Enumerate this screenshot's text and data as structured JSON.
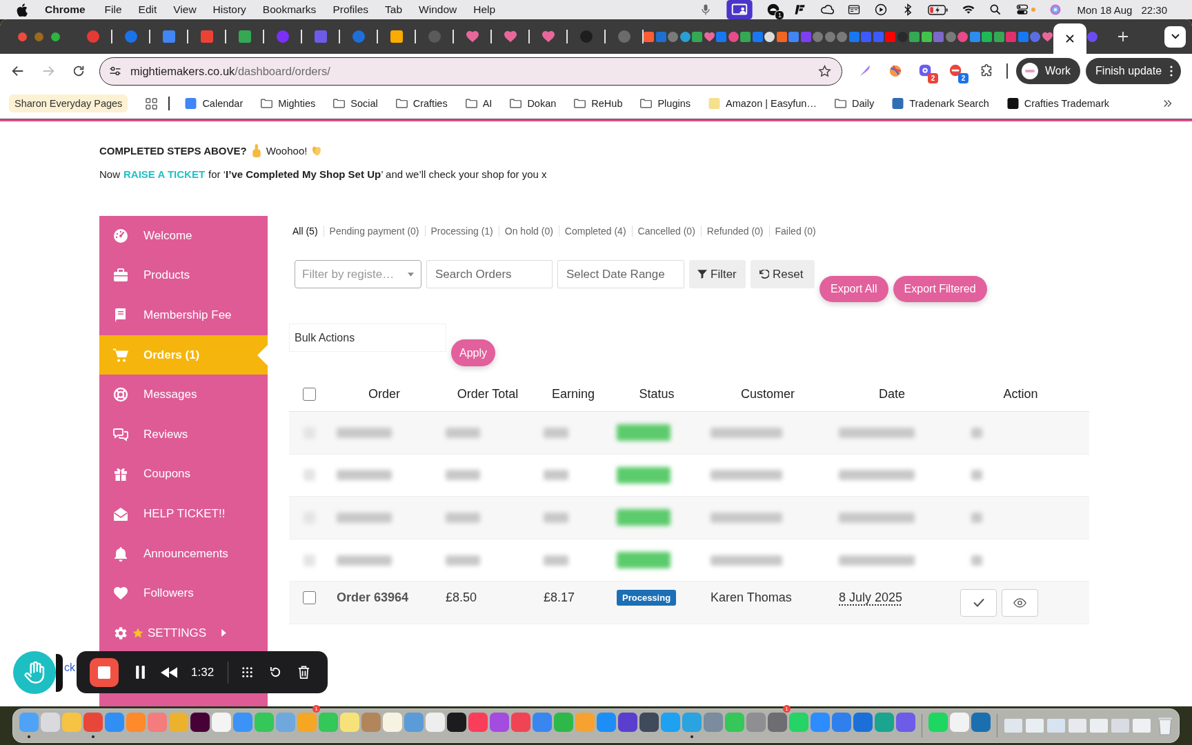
{
  "menu_bar": {
    "app": "Chrome",
    "menus": [
      "File",
      "Edit",
      "View",
      "History",
      "Bookmarks",
      "Profiles",
      "Tab",
      "Window",
      "Help"
    ],
    "status_badge": "1",
    "date": "Mon 18 Aug",
    "time": "22:30"
  },
  "tabs": [
    {
      "pinned": true,
      "selected": false,
      "kind": "circle",
      "color": "#e53935"
    },
    {
      "pinned": true,
      "selected": false,
      "kind": "circle",
      "color": "#1a73e8"
    },
    {
      "pinned": true,
      "selected": false,
      "kind": "square",
      "color": "#4285f4"
    },
    {
      "pinned": true,
      "selected": false,
      "kind": "square",
      "color": "#ea4335"
    },
    {
      "pinned": true,
      "selected": false,
      "kind": "square",
      "color": "#34a853"
    },
    {
      "pinned": true,
      "selected": false,
      "kind": "circle",
      "color": "#7b2ff7"
    },
    {
      "pinned": true,
      "selected": false,
      "kind": "square",
      "color": "#6c5ce7"
    },
    {
      "pinned": true,
      "selected": false,
      "kind": "circle",
      "color": "#1e6fd9"
    },
    {
      "pinned": true,
      "selected": false,
      "kind": "square",
      "color": "#f9ab00"
    },
    {
      "pinned": true,
      "selected": false,
      "kind": "circle",
      "color": "#5a5a5a"
    },
    {
      "pinned": true,
      "selected": false,
      "kind": "heart",
      "color": "#e8679a"
    },
    {
      "pinned": true,
      "selected": false,
      "kind": "heart",
      "color": "#e8679a"
    },
    {
      "pinned": true,
      "selected": false,
      "kind": "heart",
      "color": "#e8679a"
    },
    {
      "pinned": true,
      "selected": false,
      "kind": "circle",
      "color": "#1e1e1e"
    },
    {
      "pinned": true,
      "selected": false,
      "kind": "circle",
      "color": "#6b6b6b"
    },
    {
      "pinned": false,
      "selected": false,
      "kind": "square",
      "color": "#ff5c35"
    },
    {
      "pinned": false,
      "selected": false,
      "kind": "square",
      "color": "#1f6fd1"
    },
    {
      "pinned": false,
      "selected": false,
      "kind": "circle",
      "color": "#7a7a7a"
    },
    {
      "pinned": false,
      "selected": false,
      "kind": "circle",
      "color": "#2a9fd6"
    },
    {
      "pinned": false,
      "selected": false,
      "kind": "square",
      "color": "#34a853"
    },
    {
      "pinned": false,
      "selected": false,
      "kind": "heart",
      "color": "#e8679a"
    },
    {
      "pinned": false,
      "selected": false,
      "kind": "square",
      "color": "#1877f2"
    },
    {
      "pinned": false,
      "selected": false,
      "kind": "circle",
      "color": "#e84a8a"
    },
    {
      "pinned": false,
      "selected": false,
      "kind": "square",
      "color": "#34a853"
    },
    {
      "pinned": false,
      "selected": false,
      "kind": "square",
      "color": "#1877f2"
    },
    {
      "pinned": false,
      "selected": false,
      "kind": "circle",
      "color": "#dddddd"
    },
    {
      "pinned": false,
      "selected": false,
      "kind": "square",
      "color": "#f26522"
    },
    {
      "pinned": false,
      "selected": false,
      "kind": "square",
      "color": "#4285f4"
    },
    {
      "pinned": false,
      "selected": false,
      "kind": "square",
      "color": "#7e3ff2"
    },
    {
      "pinned": false,
      "selected": false,
      "kind": "circle",
      "color": "#7a7a7a"
    },
    {
      "pinned": false,
      "selected": false,
      "kind": "circle",
      "color": "#7a7a7a"
    },
    {
      "pinned": false,
      "selected": false,
      "kind": "circle",
      "color": "#7a7a7a"
    },
    {
      "pinned": false,
      "selected": false,
      "kind": "square",
      "color": "#1877f2"
    },
    {
      "pinned": false,
      "selected": false,
      "kind": "square",
      "color": "#3d5afe"
    },
    {
      "pinned": false,
      "selected": false,
      "kind": "square",
      "color": "#3d5afe"
    },
    {
      "pinned": false,
      "selected": false,
      "kind": "square",
      "color": "#ff0000"
    },
    {
      "pinned": false,
      "selected": false,
      "kind": "circle",
      "color": "#2a2a2a"
    },
    {
      "pinned": false,
      "selected": false,
      "kind": "square",
      "color": "#34a853"
    },
    {
      "pinned": false,
      "selected": false,
      "kind": "square",
      "color": "#43c24b"
    },
    {
      "pinned": false,
      "selected": false,
      "kind": "square",
      "color": "#7b68c8"
    },
    {
      "pinned": false,
      "selected": false,
      "kind": "circle",
      "color": "#7a7a7a"
    },
    {
      "pinned": false,
      "selected": false,
      "kind": "circle",
      "color": "#e84a8a"
    },
    {
      "pinned": false,
      "selected": false,
      "kind": "square",
      "color": "#2d8cf0"
    },
    {
      "pinned": false,
      "selected": false,
      "kind": "square",
      "color": "#1db954"
    },
    {
      "pinned": false,
      "selected": false,
      "kind": "square",
      "color": "#34a853"
    },
    {
      "pinned": false,
      "selected": false,
      "kind": "square",
      "color": "#e1306c"
    },
    {
      "pinned": false,
      "selected": false,
      "kind": "square",
      "color": "#1877f2"
    },
    {
      "pinned": false,
      "selected": false,
      "kind": "circle",
      "color": "#5b6ee1"
    },
    {
      "pinned": false,
      "selected": false,
      "kind": "heart",
      "color": "#e8679a"
    },
    {
      "pinned": false,
      "selected": true
    },
    {
      "pinned": false,
      "selected": false,
      "kind": "circle",
      "color": "#6a4cf0"
    }
  ],
  "toolbar": {
    "url_host": "mightiemakers.co.uk",
    "url_path": "/dashboard/orders/",
    "extensions": [
      {
        "badge": "2",
        "color": "#e8453c"
      },
      {
        "badge": "2",
        "color": "#1a73e8"
      }
    ],
    "profile": "Work",
    "update_button": "Finish update"
  },
  "bookmarks": {
    "tab_group": "Sharon Everyday Pages",
    "items": [
      {
        "kind": "site",
        "label": "Calendar",
        "color": "#4285f4"
      },
      {
        "kind": "folder",
        "label": "Mighties"
      },
      {
        "kind": "folder",
        "label": "Social"
      },
      {
        "kind": "folder",
        "label": "Crafties"
      },
      {
        "kind": "folder",
        "label": "AI"
      },
      {
        "kind": "folder",
        "label": "Dokan"
      },
      {
        "kind": "folder",
        "label": "ReHub"
      },
      {
        "kind": "folder",
        "label": "Plugins"
      },
      {
        "kind": "site",
        "label": "Amazon | Easyfun…",
        "color": "#f5e08c"
      },
      {
        "kind": "folder",
        "label": "Daily"
      },
      {
        "kind": "site",
        "label": "Tradenark Search",
        "color": "#2f6db5"
      },
      {
        "kind": "site",
        "label": "Crafties Trademark",
        "color": "#111111"
      }
    ]
  },
  "page": {
    "notice": {
      "title": "COMPLETED STEPS ABOVE?",
      "cheer": "Woohoo!",
      "lead": "Now",
      "link": "RAISE A TICKET",
      "rest": "for ‘**I’ve Completed My Shop Set Up**’ and we’ll check your shop for you x"
    },
    "sidebar": [
      {
        "label": "Welcome",
        "selected": false,
        "starred": false,
        "kind": "link"
      },
      {
        "label": "Products",
        "selected": false,
        "starred": false,
        "kind": "link"
      },
      {
        "label": "Membership Fee",
        "selected": false,
        "starred": false,
        "kind": "link"
      },
      {
        "label": "Orders (1)",
        "selected": true,
        "starred": false,
        "kind": "link"
      },
      {
        "label": "Messages",
        "selected": false,
        "starred": false,
        "kind": "link"
      },
      {
        "label": "Reviews",
        "selected": false,
        "starred": false,
        "kind": "link"
      },
      {
        "label": "Coupons",
        "selected": false,
        "starred": false,
        "kind": "link"
      },
      {
        "label": "HELP TICKET!!",
        "selected": false,
        "starred": false,
        "kind": "link"
      },
      {
        "label": "Announcements",
        "selected": false,
        "starred": false,
        "kind": "link"
      },
      {
        "label": "Followers",
        "selected": false,
        "starred": false,
        "kind": "link"
      },
      {
        "label": "SETTINGS",
        "selected": false,
        "starred": true,
        "kind": "submenu"
      }
    ],
    "status_filters": [
      {
        "label": "All (5)",
        "selected": true
      },
      {
        "label": "Pending payment (0)",
        "selected": false
      },
      {
        "label": "Processing (1)",
        "selected": false
      },
      {
        "label": "On hold (0)",
        "selected": false
      },
      {
        "label": "Completed (4)",
        "selected": false
      },
      {
        "label": "Cancelled (0)",
        "selected": false
      },
      {
        "label": "Refunded (0)",
        "selected": false
      },
      {
        "label": "Failed (0)",
        "selected": false
      }
    ],
    "filters": {
      "customer_placeholder": "Filter by registe…",
      "search_placeholder": "Search Orders",
      "date_placeholder": "Select Date Range",
      "filter_button": "Filter",
      "reset_button": "Reset",
      "export_buttons": [
        "Export All",
        "Export Filtered"
      ]
    },
    "bulk": {
      "action": "Bulk Actions",
      "apply_button": "Apply"
    },
    "table": {
      "select_all_checked": false,
      "columns": [
        "Order",
        "Order Total",
        "Earning",
        "Status",
        "Customer",
        "Date",
        "Action"
      ],
      "rows": [
        {
          "kind": "blurred"
        },
        {
          "kind": "blurred"
        },
        {
          "kind": "blurred"
        },
        {
          "kind": "blurred"
        },
        {
          "kind": "order",
          "checked": false,
          "order": "Order 63964",
          "total": "£8.50",
          "earning": "£8.17",
          "status": "Processing",
          "customer": "Karen Thomas",
          "date": "8 July 2025"
        }
      ]
    }
  },
  "recorder": {
    "partial_link": "ck",
    "elapsed": "1:32"
  },
  "dock": {
    "apps": [
      {
        "color": "#4fa3f7",
        "running": true
      },
      {
        "color": "#d9d9de",
        "running": false
      },
      {
        "color": "#f6c343",
        "running": false
      },
      {
        "color": "#e9463a",
        "running": true
      },
      {
        "color": "#2f8ff5",
        "running": false
      },
      {
        "color": "#ff8a2b",
        "running": false
      },
      {
        "color": "#f47c7c",
        "running": false
      },
      {
        "color": "#ecb22e",
        "running": false
      },
      {
        "color": "#470137",
        "running": false
      },
      {
        "color": "#f4f4f4",
        "running": false
      },
      {
        "color": "#3b93f7",
        "running": false
      },
      {
        "color": "#35c759",
        "running": false
      },
      {
        "color": "#6fa8dc",
        "running": false
      },
      {
        "color": "#f5a623",
        "running": false,
        "badge": "1"
      },
      {
        "color": "#34c759",
        "running": false
      },
      {
        "color": "#f7e27a",
        "running": false
      },
      {
        "color": "#b0865a",
        "running": false
      },
      {
        "color": "#f7f3e3",
        "running": false
      },
      {
        "color": "#5a9bd8",
        "running": false
      },
      {
        "color": "#eeeeee",
        "running": false
      },
      {
        "color": "#1c1c1e",
        "running": false
      },
      {
        "color": "#fa3e5a",
        "running": false
      },
      {
        "color": "#a44ce0",
        "running": false
      },
      {
        "color": "#f04454",
        "running": false
      },
      {
        "color": "#3a86f0",
        "running": false
      },
      {
        "color": "#2fb84a",
        "running": false
      },
      {
        "color": "#f7a230",
        "running": false
      },
      {
        "color": "#1e8ef7",
        "running": false
      },
      {
        "color": "#5a3fcf",
        "running": false
      },
      {
        "color": "#3f4a5a",
        "running": false
      },
      {
        "color": "#1ea1f1",
        "running": false
      },
      {
        "color": "#2aa3e0",
        "running": true
      },
      {
        "color": "#7a8c9e",
        "running": false
      },
      {
        "color": "#35c759",
        "running": false
      },
      {
        "color": "#8e8e93",
        "running": false
      },
      {
        "color": "#6d6d72",
        "running": false,
        "badge": "1"
      },
      {
        "color": "#25d366",
        "running": false
      },
      {
        "color": "#2d8cff",
        "running": false
      },
      {
        "color": "#2f80ed",
        "running": false
      },
      {
        "color": "#1b70d8",
        "running": false
      },
      {
        "color": "#19a58e",
        "running": false
      },
      {
        "color": "#6c5ce7",
        "running": false
      }
    ],
    "recent_apps": [
      {
        "color": "#1ed760",
        "running": false
      },
      {
        "color": "#f2f2f2",
        "running": false
      },
      {
        "color": "#1b6fb0",
        "running": false
      }
    ],
    "windows": [
      {
        "color": "#dfe6ee"
      },
      {
        "color": "#e9eef3"
      },
      {
        "color": "#d7e3f0"
      },
      {
        "color": "#e7e9ef"
      },
      {
        "color": "#eceff2"
      },
      {
        "color": "#d9dde3"
      },
      {
        "color": "#eef0f3"
      }
    ]
  }
}
